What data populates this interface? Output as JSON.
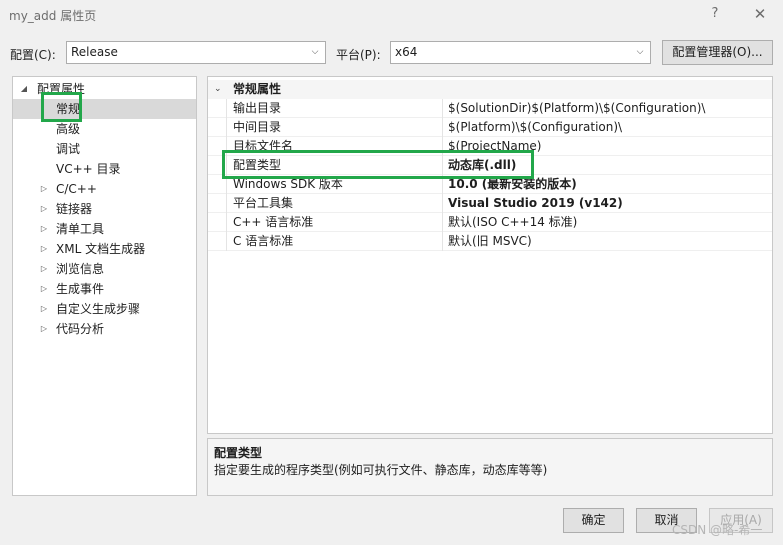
{
  "window": {
    "title": "my_add 属性页",
    "help_glyph": "?",
    "close_glyph": "✕"
  },
  "toolbar": {
    "config_label": "配置(C):",
    "config_value": "Release",
    "platform_label": "平台(P):",
    "platform_value": "x64",
    "manager_button": "配置管理器(O)..."
  },
  "tree": {
    "root": "配置属性",
    "items": [
      {
        "label": "常规",
        "expandable": false,
        "selected": true
      },
      {
        "label": "高级",
        "expandable": false
      },
      {
        "label": "调试",
        "expandable": false
      },
      {
        "label": "VC++ 目录",
        "expandable": false
      },
      {
        "label": "C/C++",
        "expandable": true
      },
      {
        "label": "链接器",
        "expandable": true
      },
      {
        "label": "清单工具",
        "expandable": true
      },
      {
        "label": "XML 文档生成器",
        "expandable": true
      },
      {
        "label": "浏览信息",
        "expandable": true
      },
      {
        "label": "生成事件",
        "expandable": true
      },
      {
        "label": "自定义生成步骤",
        "expandable": true
      },
      {
        "label": "代码分析",
        "expandable": true
      }
    ]
  },
  "grid": {
    "category": "常规属性",
    "rows": [
      {
        "name": "输出目录",
        "value": "$(SolutionDir)$(Platform)\\$(Configuration)\\",
        "bold": false
      },
      {
        "name": "中间目录",
        "value": "$(Platform)\\$(Configuration)\\",
        "bold": false
      },
      {
        "name": "目标文件名",
        "value": "$(ProjectName)",
        "bold": false
      },
      {
        "name": "配置类型",
        "value": "动态库(.dll)",
        "bold": true
      },
      {
        "name": "Windows SDK 版本",
        "value": "10.0 (最新安装的版本)",
        "bold": true
      },
      {
        "name": "平台工具集",
        "value": "Visual Studio 2019 (v142)",
        "bold": true
      },
      {
        "name": "C++ 语言标准",
        "value": "默认(ISO C++14 标准)",
        "bold": false
      },
      {
        "name": "C 语言标准",
        "value": "默认(旧 MSVC)",
        "bold": false
      }
    ]
  },
  "description": {
    "title": "配置类型",
    "text": "指定要生成的程序类型(例如可执行文件、静态库，动态库等等)"
  },
  "buttons": {
    "ok": "确定",
    "cancel": "取消",
    "apply": "应用(A)"
  },
  "watermark": "CSDN @略-希一",
  "colors": {
    "highlight_box": "#22a74a",
    "selected_row": "#d9d9d9"
  }
}
